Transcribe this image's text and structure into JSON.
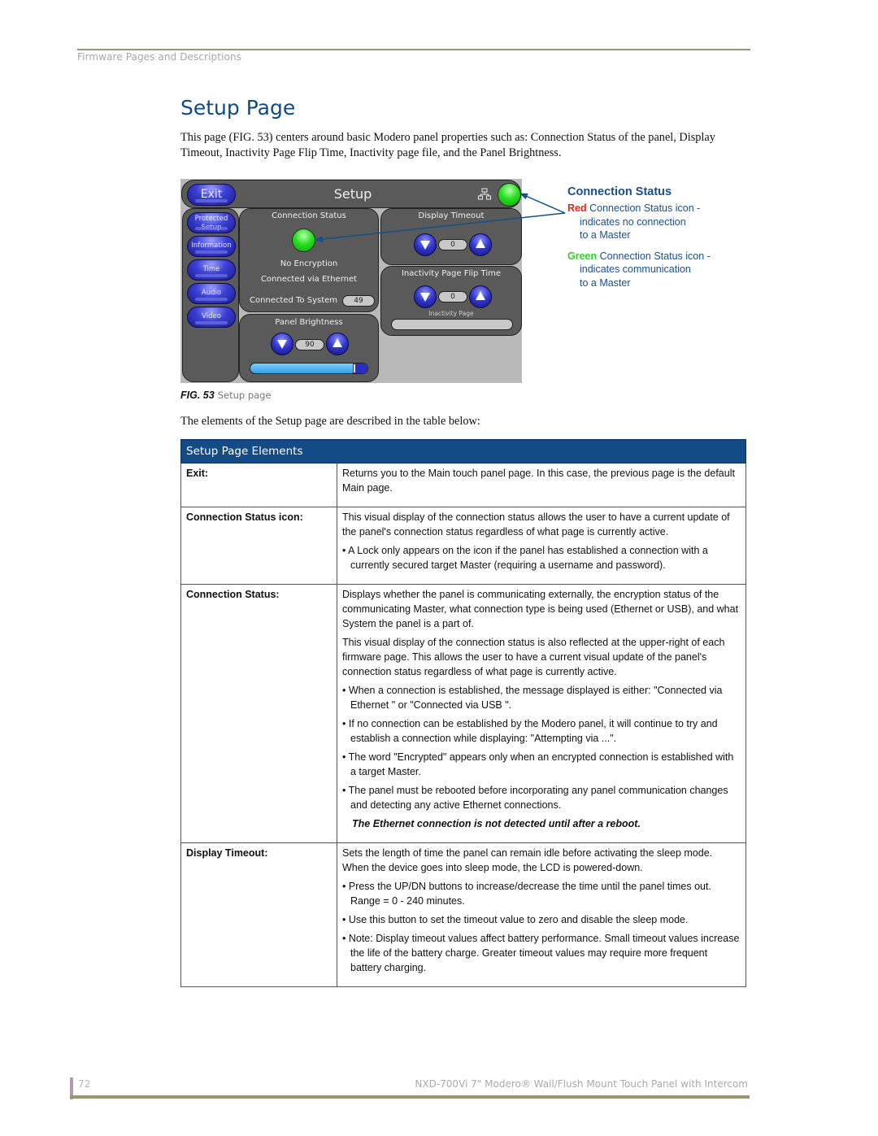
{
  "header": {
    "running_head": "Firmware Pages and Descriptions"
  },
  "title": "Setup Page",
  "intro": "This page (FIG. 53) centers around basic Modero panel properties such as: Connection Status of the panel, Display Timeout, Inactivity Page Flip Time, Inactivity page file, and the Panel Brightness.",
  "figure": {
    "panel": {
      "exit_label": "Exit",
      "title": "Setup",
      "network_icon": "network-icon",
      "status_led_color": "#29e021",
      "sidebar": [
        {
          "label": "Protected Setup"
        },
        {
          "label": "Information"
        },
        {
          "label": "Time"
        },
        {
          "label": "Audio"
        },
        {
          "label": "Video"
        }
      ],
      "connection_status": {
        "title": "Connection Status",
        "encryption": "No Encryption",
        "connection": "Connected via Ethernet",
        "system_label": "Connected To System",
        "system_value": "49"
      },
      "display_timeout": {
        "title": "Display Timeout",
        "value": "0"
      },
      "inactivity": {
        "title": "Inactivity Page Flip Time",
        "value": "0",
        "page_label": "Inactivity Page",
        "page_value": ""
      },
      "brightness": {
        "title": "Panel Brightness",
        "value": "90",
        "slider_fraction": 0.9
      }
    },
    "legend": {
      "title": "Connection Status",
      "items": [
        {
          "color_word": "Red",
          "color": "#e8211d",
          "text1": "Connection Status icon -",
          "text2": "indicates no connection",
          "text3": "to a Master"
        },
        {
          "color_word": "Green",
          "color": "#2fd22a",
          "text1": "Connection Status icon -",
          "text2": "indicates communication",
          "text3": "to a Master"
        }
      ]
    },
    "caption_label": "FIG. 53",
    "caption_text": "Setup page"
  },
  "lead": "The elements of the Setup page are described in the table below:",
  "table": {
    "title": "Setup Page Elements",
    "rows": [
      {
        "key": "Exit:",
        "paras": [
          {
            "type": "p",
            "text": "Returns you to the Main touch panel page. In this case, the previous page is the default Main page."
          }
        ]
      },
      {
        "key": "Connection Status icon:",
        "paras": [
          {
            "type": "p",
            "text": "This visual display of the connection status allows the user to have a current update of the panel's connection status regardless of what page is currently active."
          },
          {
            "type": "b",
            "text": "A Lock only appears on the icon if the panel has established a connection with a currently secured target Master (requiring a username and password)."
          }
        ]
      },
      {
        "key": "Connection Status:",
        "paras": [
          {
            "type": "p",
            "text": "Displays whether the panel is communicating externally, the encryption status of the communicating Master, what connection type is being used (Ethernet or USB), and what System the panel is a part of."
          },
          {
            "type": "p",
            "text": "This visual display of the connection status is also reflected at the upper-right of each firmware page. This allows the user to have a current visual update of the panel's connection status regardless of what page is currently active."
          },
          {
            "type": "b",
            "text": "When a connection is established, the message displayed is either: \"Connected via Ethernet \" or \"Connected via USB \"."
          },
          {
            "type": "b",
            "text": "If no connection can be established by the Modero panel, it will continue to try and establish a connection while displaying: \"Attempting via ...\"."
          },
          {
            "type": "b",
            "text": "The word \"Encrypted\" appears only when an encrypted connection is established with a target Master."
          },
          {
            "type": "b",
            "text": "The panel must be rebooted before incorporating any panel communication changes and detecting any active Ethernet connections."
          },
          {
            "type": "strong",
            "text": "The Ethernet connection is not detected until after a reboot."
          }
        ]
      },
      {
        "key": "Display Timeout:",
        "paras": [
          {
            "type": "p",
            "text": "Sets the length of time the panel can remain idle before activating the sleep mode. When the device goes into sleep mode, the LCD is powered-down."
          },
          {
            "type": "b",
            "text": "Press the UP/DN buttons to increase/decrease the time until the panel times out. Range = 0 - 240 minutes."
          },
          {
            "type": "b",
            "text": "Use this button to set the timeout value to zero and disable the sleep mode."
          },
          {
            "type": "b",
            "text": "Note: Display timeout values affect battery performance. Small timeout values increase the life of the battery charge. Greater timeout values may require more frequent battery charging."
          }
        ]
      }
    ]
  },
  "footer": {
    "page_number": "72",
    "doc_title": "NXD-700Vi 7\" Modero® Wall/Flush Mount Touch Panel with Intercom"
  }
}
